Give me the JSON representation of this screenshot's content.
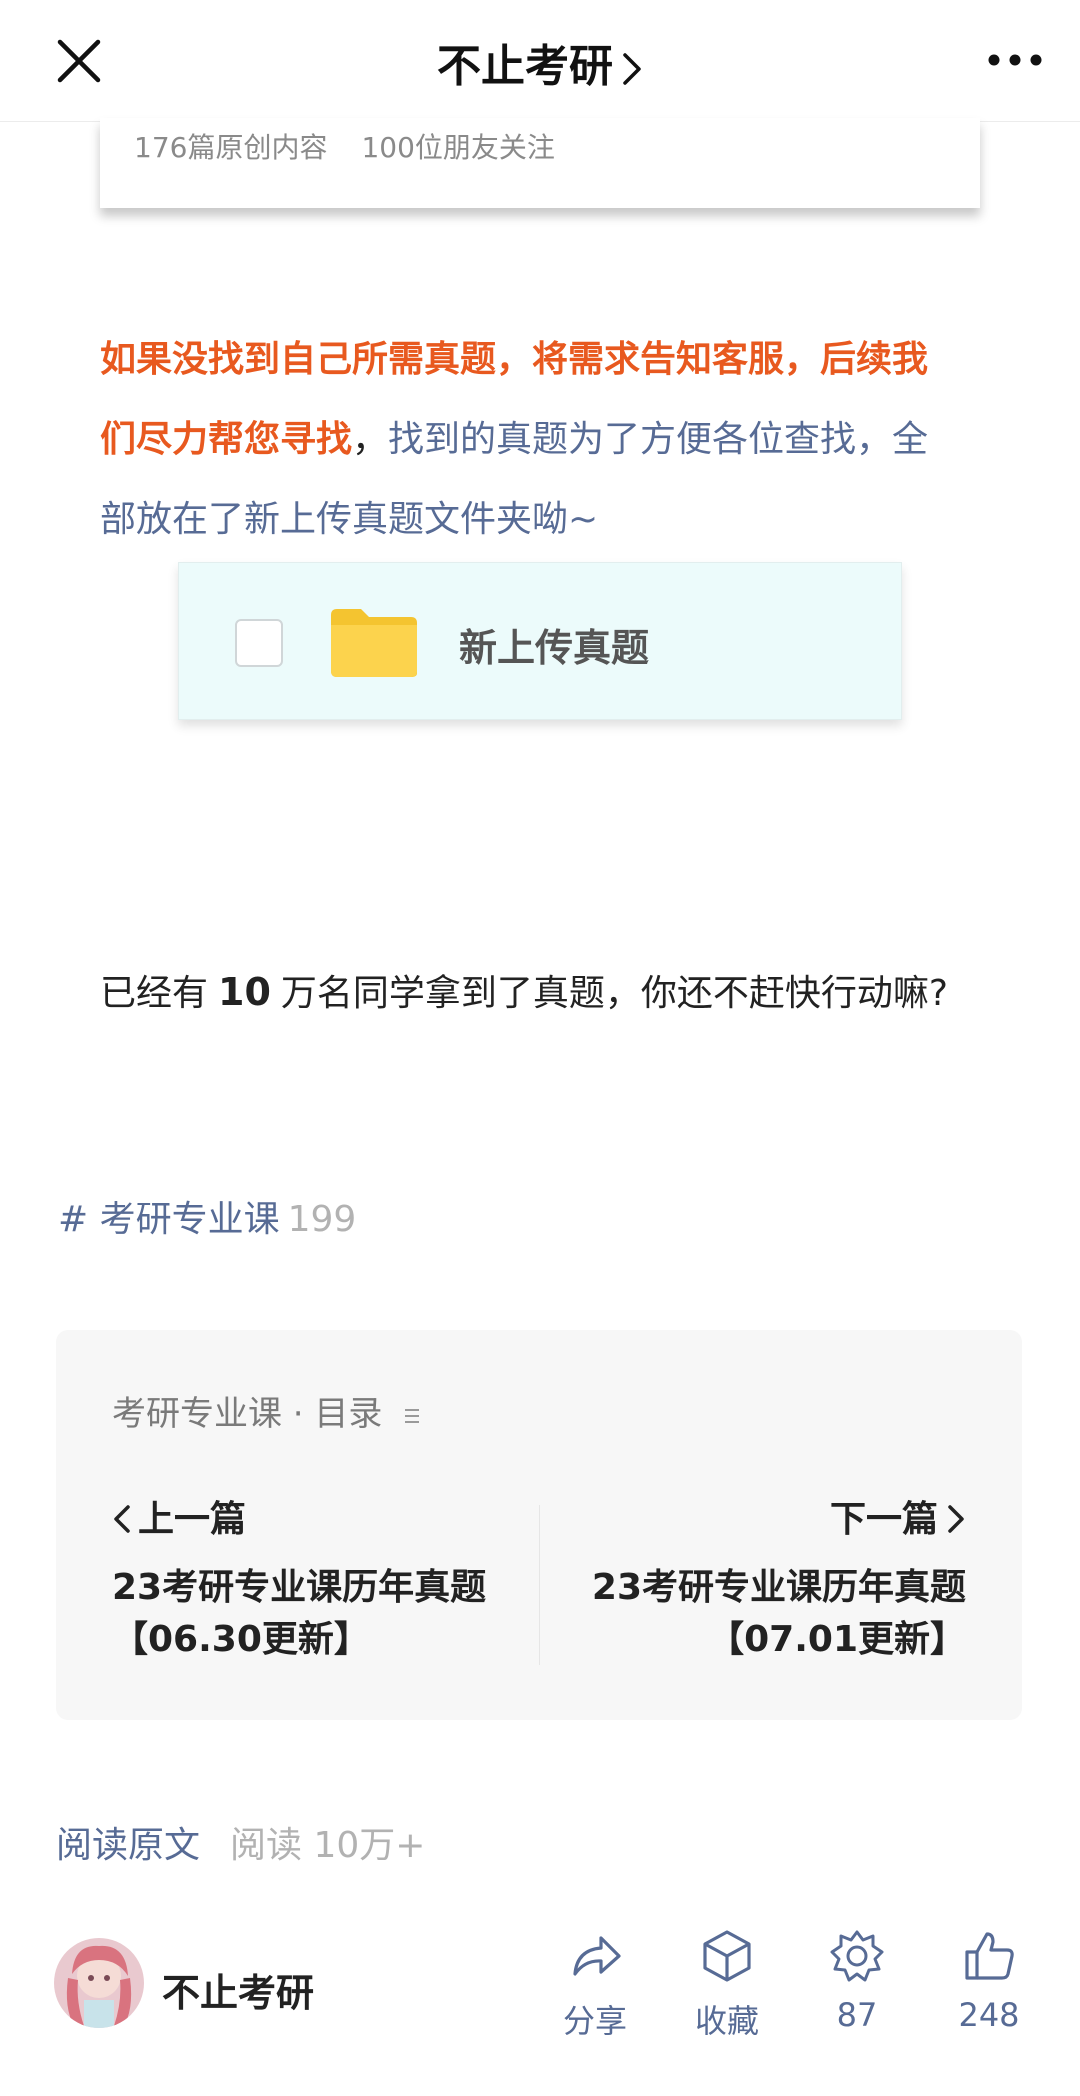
{
  "nav": {
    "title": "不止考研"
  },
  "card": {
    "original_count": "176篇原创内容",
    "followers": "100位朋友关注"
  },
  "article": {
    "para1_orange": "如果没找到自己所需真题，将需求告知客服，后续我们尽力帮您寻找",
    "para1_comma": "，",
    "para1_blue": "找到的真题为了方便各位查找，全部放在了新上传真题文件夹呦~",
    "folder_name": "新上传真题",
    "para2_prefix": "已经有",
    "para2_number": "10",
    "para2_suffix": "万名同学拿到了真题，你还不赶快行动嘛?"
  },
  "hashtag": {
    "label": "# 考研专业课",
    "count": "199"
  },
  "album": {
    "header": "考研专业课 · 目录",
    "prev_label": "上一篇",
    "prev_title": "23考研专业课历年真题【06.30更新】",
    "next_label": "下一篇",
    "next_title": "23考研专业课历年真题【07.01更新】"
  },
  "read": {
    "original_label": "阅读原文",
    "count_label": "阅读 10万+"
  },
  "bottom": {
    "account_name": "不止考研",
    "share_label": "分享",
    "favorite_label": "收藏",
    "wow_count": "87",
    "like_count": "248"
  },
  "colors": {
    "link_blue": "#576b95",
    "highlight_orange": "#e8591f",
    "folder_yellow": "#fcd34d"
  }
}
